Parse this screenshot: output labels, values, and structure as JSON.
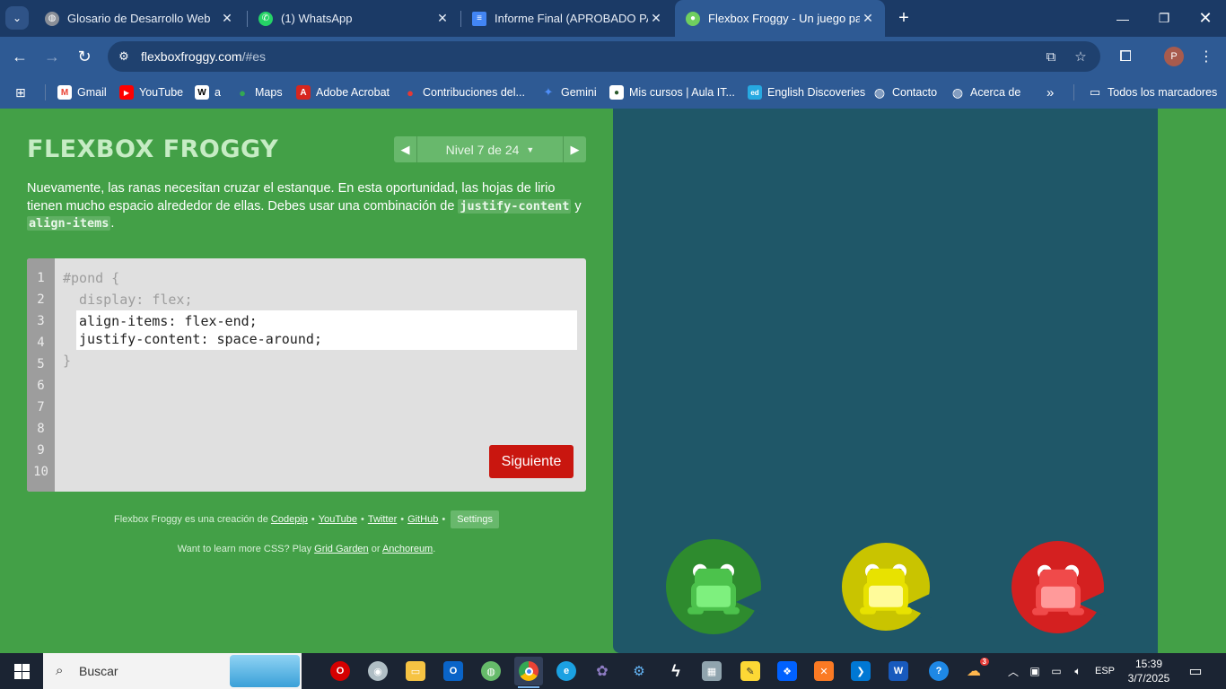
{
  "tabs": [
    {
      "title": "Glosario de Desarrollo Web",
      "favicon": "globe-icon",
      "color": "#8a8f98"
    },
    {
      "title": "(1) WhatsApp",
      "favicon": "whatsapp-icon",
      "color": "#25d366"
    },
    {
      "title": "Informe Final (APROBADO PARA",
      "favicon": "docs-icon",
      "color": "#4285f4"
    },
    {
      "title": "Flexbox Froggy - Un juego para",
      "favicon": "frog-icon",
      "color": "#6fcf5f"
    }
  ],
  "address_bar": {
    "host": "flexboxfroggy.com",
    "path": "/#es"
  },
  "bookmarks": [
    {
      "label": "Gmail",
      "icon": "gmail-icon",
      "color": "#ea4335",
      "glyph": "M"
    },
    {
      "label": "YouTube",
      "icon": "youtube-icon",
      "color": "#ff0000",
      "glyph": "▶"
    },
    {
      "label": "a",
      "icon": "wikipedia-icon",
      "color": "#ffffff",
      "glyph": "W"
    },
    {
      "label": "Maps",
      "icon": "maps-icon",
      "color": "#34a853",
      "glyph": "●"
    },
    {
      "label": "Adobe Acrobat",
      "icon": "acrobat-icon",
      "color": "#d7261e",
      "glyph": "A"
    },
    {
      "label": "Contribuciones del...",
      "icon": "contribuciones-icon",
      "color": "#e53935",
      "glyph": "●"
    },
    {
      "label": "Gemini",
      "icon": "gemini-icon",
      "color": "#4f8ef7",
      "glyph": "✦"
    },
    {
      "label": "Mis cursos | Aula IT...",
      "icon": "aula-icon",
      "color": "#ffffff",
      "glyph": "●"
    },
    {
      "label": "English Discoveries",
      "icon": "ed-icon",
      "color": "#27a9e1",
      "glyph": "ed"
    },
    {
      "label": "Contacto",
      "icon": "globe-icon",
      "color": "#ffffff",
      "glyph": "◍"
    },
    {
      "label": "Acerca de",
      "icon": "globe-icon",
      "color": "#ffffff",
      "glyph": "◍"
    }
  ],
  "bookmarks_more": "»",
  "all_bookmarks": "Todos los marcadores",
  "game": {
    "logo": "FLEXBOX FROGGY",
    "level_label": "Nivel 7 de 24",
    "instructions_pre": "Nuevamente, las ranas necesitan cruzar el estanque. En esta oportunidad, las hojas de lirio tienen mucho espacio alrededor de ellas. Debes usar una combinación de ",
    "code_term_1": "justify-content",
    "instructions_mid": " y ",
    "code_term_2": "align-items",
    "instructions_post": ".",
    "line_numbers": [
      "1",
      "2",
      "3",
      "4",
      "5",
      "6",
      "7",
      "8",
      "9",
      "10"
    ],
    "code_line_1": "#pond {",
    "code_line_2": "  display: flex;",
    "user_line_1": "align-items: flex-end;",
    "user_line_2": "justify-content: space-around;",
    "code_line_5": "}",
    "next_button": "Siguiente",
    "footer": {
      "credit_prefix": "Flexbox Froggy es una creación de",
      "codepip": "Codepip",
      "youtube": "YouTube",
      "twitter": "Twitter",
      "github": "GitHub",
      "settings": "Settings",
      "more_prefix": "Want to learn more CSS? Play",
      "grid_garden": "Grid Garden",
      "or": "or",
      "anchoreum": "Anchoreum",
      "more_suffix": "."
    },
    "frogs": [
      {
        "color": "green",
        "pad": "#2e8b2e",
        "body": "#4cc24c",
        "belly": "#7ef07e"
      },
      {
        "color": "yellow",
        "pad": "#c9c400",
        "body": "#e8e200",
        "belly": "#fffb9a"
      },
      {
        "color": "red",
        "pad": "#d42020",
        "body": "#f04a4a",
        "belly": "#ff9a9a"
      }
    ]
  },
  "taskbar": {
    "search_placeholder": "Buscar",
    "time": "15:39",
    "date": "3/7/2025",
    "language": "ESP",
    "weather_badge": "3"
  }
}
